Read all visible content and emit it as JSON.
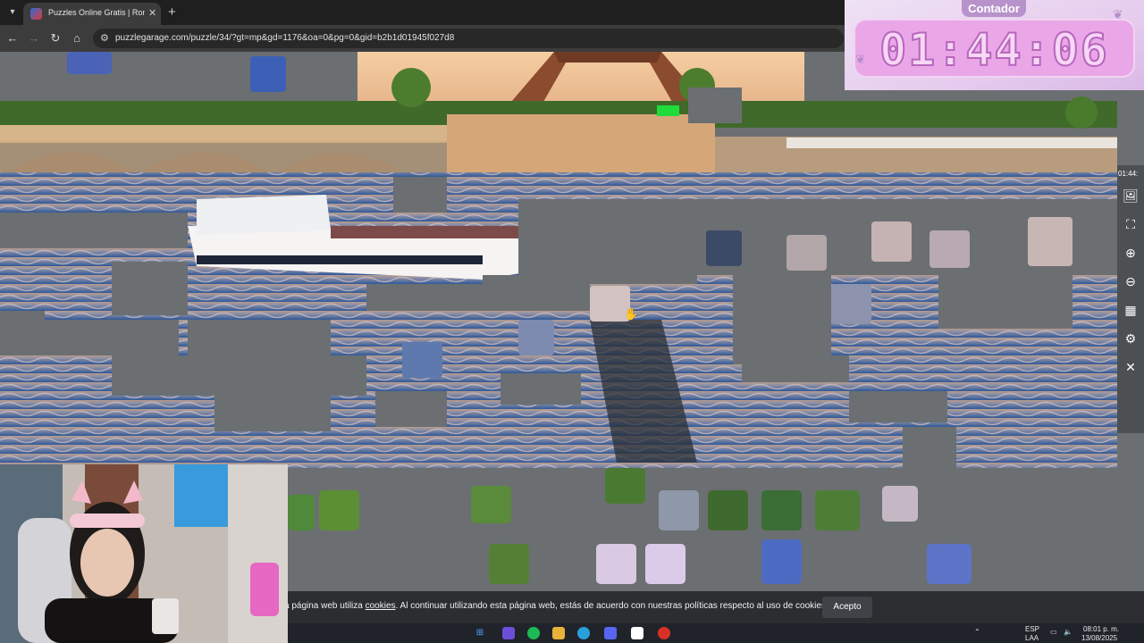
{
  "browser": {
    "tab_title": "Puzzles Online Gratis | Rompec",
    "url": "puzzlegarage.com/puzzle/34/?gt=mp&gd=1176&oa=0&pg=0&gid=b2b1d01945f027d8"
  },
  "counter": {
    "label": "Contador",
    "time": "01:44:06"
  },
  "toolbar_right": {
    "mini_time": "01:44:"
  },
  "cookie_banner": {
    "text_before": "a página web utiliza ",
    "link": "cookies",
    "text_after": ". Al continuar utilizando esta página web, estás de acuerdo con nuestras políticas respecto al uso de cookies.",
    "accept": "Acepto"
  },
  "taskbar": {
    "lang_top": "ESP",
    "lang_bottom": "LAA",
    "time": "08:01 p. m.",
    "date": "13/08/2025"
  },
  "colors": {
    "board_bg": "#6b6f72",
    "water": "#3a5f9c",
    "sky": "#f2c9a0"
  }
}
